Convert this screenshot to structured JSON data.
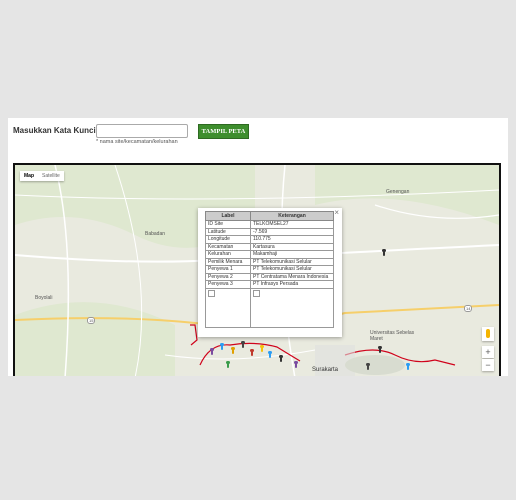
{
  "search": {
    "label": "Masukkan Kata Kunci :",
    "value": "",
    "hint": "* nama site/kecamatan/kelurahan"
  },
  "button": {
    "label": "TAMPIL PETA"
  },
  "map": {
    "type_toggle": {
      "map": "Map",
      "satellite": "Satellite",
      "selected": "Map"
    },
    "places": {
      "genengan": "Genengan",
      "babadan": "Babadan",
      "boyolali": "Boyolali",
      "universitas": "Universitas Sebelas Maret",
      "surakarta": "Surakarta",
      "road_15": "15",
      "road_14": "14"
    },
    "zoom": {
      "in": "+",
      "out": "−"
    }
  },
  "popup": {
    "close": "×",
    "headers": {
      "label": "Label",
      "value": "Keterangan"
    },
    "rows": [
      {
        "label": "ID Site",
        "value": "TELKOMSEL27"
      },
      {
        "label": "Latitude",
        "value": "-7.569"
      },
      {
        "label": "Longitude",
        "value": "110.775"
      },
      {
        "label": "Kecamatan",
        "value": "Kartasura"
      },
      {
        "label": "Kelurahan",
        "value": "Makamhaji"
      },
      {
        "label": "Pemilik Menara",
        "value": "PT Telekomunikasi Selular"
      },
      {
        "label": "Penyewa 1",
        "value": "PT Telekomunikasi Selular"
      },
      {
        "label": "Penyewa 2",
        "value": "PT Centratama Menara Indonesia"
      },
      {
        "label": "Penyewa 3",
        "value": "PT Infrasys Persada"
      }
    ]
  },
  "colors": {
    "button": "#3e8e2e",
    "boundary": "#d0021b",
    "map_bg": "#e9eadf"
  }
}
